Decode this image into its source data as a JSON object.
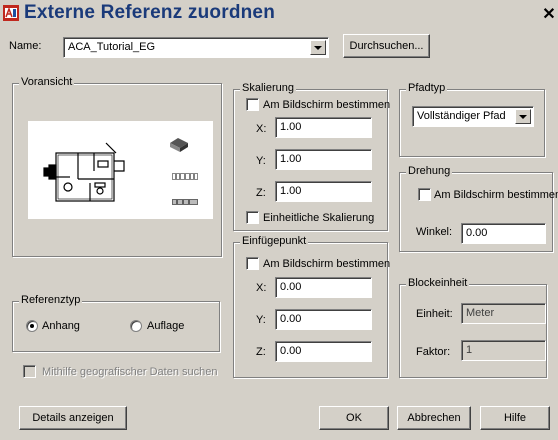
{
  "window": {
    "title": "Externe Referenz zuordnen",
    "close_glyph": "✕"
  },
  "name_row": {
    "label": "Name:",
    "value": "ACA_Tutorial_EG",
    "browse_label": "Durchsuchen..."
  },
  "preview": {
    "label": "Voransicht"
  },
  "reference_type": {
    "label": "Referenztyp",
    "options": [
      {
        "label": "Anhang",
        "selected": true
      },
      {
        "label": "Auflage",
        "selected": false
      }
    ]
  },
  "geo_search": {
    "label": "Mithilfe geografischer Daten suchen",
    "enabled": false
  },
  "scaling": {
    "label": "Skalierung",
    "onscreen_label": "Am Bildschirm bestimmen",
    "x_label": "X:",
    "x_value": "1.00",
    "y_label": "Y:",
    "y_value": "1.00",
    "z_label": "Z:",
    "z_value": "1.00",
    "uniform_label": "Einheitliche Skalierung"
  },
  "insertion_point": {
    "label": "Einfügepunkt",
    "onscreen_label": "Am Bildschirm bestimmen",
    "x_label": "X:",
    "x_value": "0.00",
    "y_label": "Y:",
    "y_value": "0.00",
    "z_label": "Z:",
    "z_value": "0.00"
  },
  "path_type": {
    "label": "Pfadtyp",
    "value": "Vollständiger Pfad"
  },
  "rotation": {
    "label": "Drehung",
    "onscreen_label": "Am Bildschirm bestimmen",
    "angle_label": "Winkel:",
    "angle_value": "0.00"
  },
  "block_unit": {
    "label": "Blockeinheit",
    "unit_label": "Einheit:",
    "unit_value": "Meter",
    "factor_label": "Faktor:",
    "factor_value": "1"
  },
  "buttons": {
    "details": "Details anzeigen",
    "ok": "OK",
    "cancel": "Abbrechen",
    "help": "Hilfe"
  }
}
